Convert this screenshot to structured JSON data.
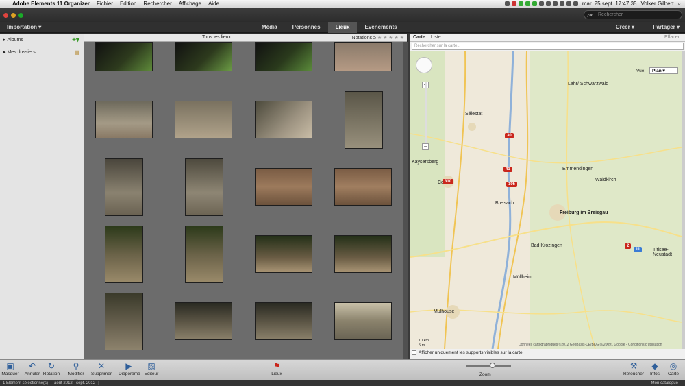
{
  "menubar": {
    "app": "Adobe Elements 11 Organizer",
    "menus": [
      "Fichier",
      "Edition",
      "Rechercher",
      "Affichage",
      "Aide"
    ],
    "clock": "mar. 25 sept.  17:47:35",
    "user": "Volker Gilbert"
  },
  "search": {
    "placeholder": "Rechercher"
  },
  "toolbar": {
    "importation": "Importation",
    "tabs": [
      "Média",
      "Personnes",
      "Lieux",
      "Evénements"
    ],
    "active_tab": "Lieux",
    "creer": "Créer",
    "partager": "Partager"
  },
  "left_panel": {
    "albums": "Albums",
    "folders": "Mes dossiers"
  },
  "grid": {
    "title": "Tous les lieux",
    "rating_label": "Notations",
    "rating_op": "≥",
    "stars": "★ ★ ★ ★ ★"
  },
  "map": {
    "tab_carte": "Carte",
    "tab_liste": "Liste",
    "clear": "Effacer",
    "search_placeholder": "Rechercher sur la carte...",
    "view_label": "Vue:",
    "view_value": "Plan",
    "pins": [
      "30",
      "41",
      "105",
      "310",
      "2",
      "11"
    ],
    "cities": [
      "Sélestat",
      "Colmar",
      "Freiburg im Breisgau",
      "Emmendingen",
      "Mulhouse",
      "Breisach",
      "Bad Krozingen",
      "Kaysersberg",
      "Waldkirch",
      "Titisee-Neustadt",
      "Lahr/ Schwarzwald",
      "Müllheim"
    ],
    "scale_km": "10 km",
    "scale_mi": "5 mi",
    "copyright": "Données cartographiques ©2012 GeoBasis-DE/BKG (©2009), Google - Conditions d'utilisation",
    "footer": "Afficher uniquement les supports visibles sur la carte"
  },
  "bottom": {
    "masquer": "Masquer",
    "annuler": "Annuler",
    "rotation": "Rotation",
    "modifier": "Modifier ...",
    "supprimer": "Supprimer",
    "diaporama": "Diaporama",
    "editeur": "Editeur",
    "lieux": "Lieux",
    "zoom": "Zoom",
    "retoucher": "Retoucher",
    "infos": "Infos",
    "carte": "Carte"
  },
  "status": {
    "selected": "1 Elément sélectionné(s)",
    "range": "août 2012 - sept. 2012",
    "catalog": "Mon catalogue"
  },
  "colors": {
    "accent_tab": "#555555",
    "pin": "#c9261c",
    "map_bg": "#efe9da"
  }
}
